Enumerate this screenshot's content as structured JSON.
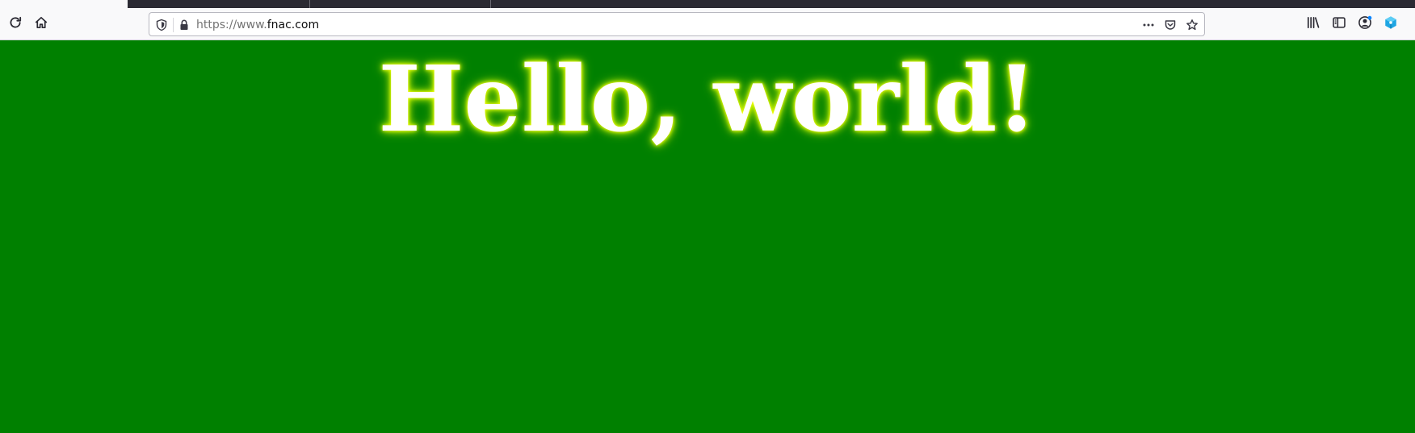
{
  "browser": {
    "url_scheme_prefix": "https://www.",
    "url_host": "fnac.com",
    "icons": {
      "reload": "reload-icon",
      "home": "home-icon",
      "tracking_protection": "shield-icon",
      "lock": "lock-icon",
      "page_actions": "more-dots-icon",
      "pocket": "pocket-icon",
      "bookmark": "star-icon",
      "library": "library-icon",
      "sidebar": "sidebar-icon",
      "account": "account-icon",
      "extension": "extension-cube-icon"
    }
  },
  "page": {
    "heading": "Hello, world!",
    "background_color": "#008000",
    "heading_color": "#ffffff",
    "glow_color": "#ffff00"
  }
}
